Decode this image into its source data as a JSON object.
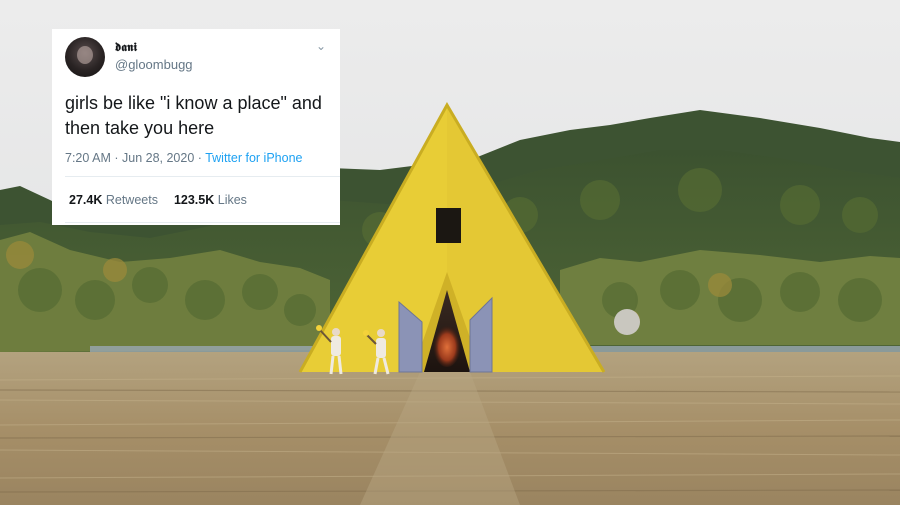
{
  "tweet": {
    "display_name": "𝖉𝖆𝖓𝖎",
    "handle": "@gloombugg",
    "text": "girls be like \"i know a place\" and then take you here",
    "time": "7:20 AM",
    "date": "Jun 28, 2020",
    "source": "Twitter for iPhone",
    "retweets_count": "27.4K",
    "retweets_label": "Retweets",
    "likes_count": "123.5K",
    "likes_label": "Likes"
  },
  "icons": {
    "menu": "chevron-down-icon"
  },
  "colors": {
    "tweet_bg": "#ffffff",
    "link_blue": "#1da1f2",
    "muted": "#657786",
    "sky": "#e9e9ea",
    "pyramid_yellow": "#e9cf38",
    "field": "#a8926d"
  }
}
